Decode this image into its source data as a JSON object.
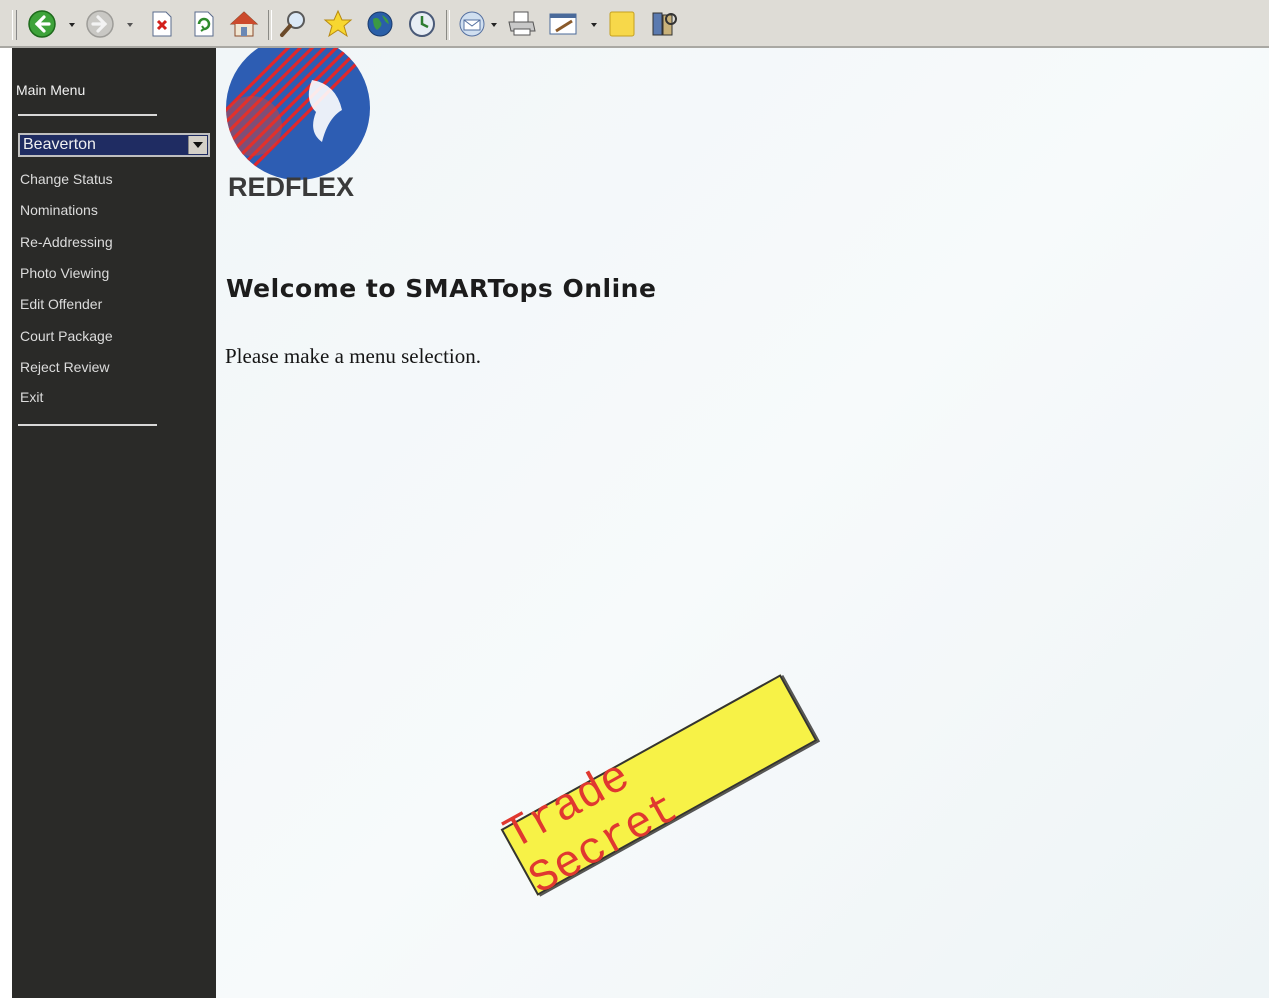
{
  "toolbar": {
    "buttons": [
      "back-icon",
      "forward-icon",
      "stop-icon",
      "refresh-icon",
      "home-icon",
      "search-icon",
      "favorites-icon",
      "media-icon",
      "history-icon",
      "mail-icon",
      "print-icon",
      "edit-icon",
      "notes-icon",
      "research-icon"
    ]
  },
  "sidebar": {
    "title": "Main Menu",
    "location_select": {
      "value": "Beaverton"
    },
    "items": [
      {
        "label": "Change Status"
      },
      {
        "label": "Nominations"
      },
      {
        "label": "Re-Addressing"
      },
      {
        "label": "Photo Viewing"
      },
      {
        "label": "Edit Offender"
      },
      {
        "label": "Court Package"
      },
      {
        "label": "Reject Review"
      },
      {
        "label": "Exit"
      }
    ]
  },
  "main": {
    "logo_text": "REDFLEX",
    "welcome": "Welcome to SMARTops Online",
    "prompt": "Please make a menu selection."
  },
  "stamp": {
    "text": "Trade Secret",
    "bg_color": "#f7f247",
    "text_color": "#e03830"
  }
}
